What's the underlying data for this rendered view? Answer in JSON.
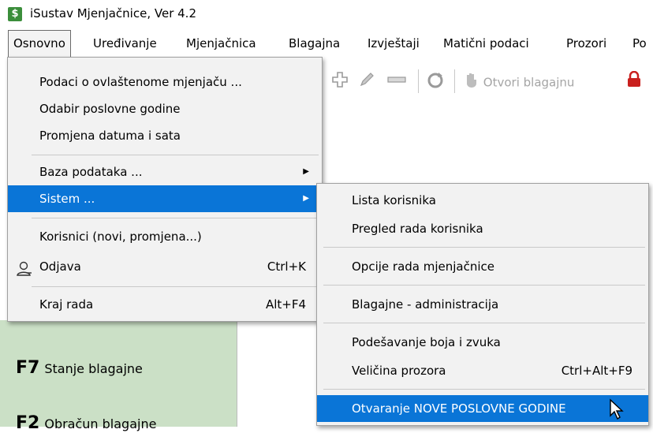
{
  "window": {
    "title": "iSustav Mjenjačnice, Ver 4.2",
    "icon": "dollar-app-icon",
    "icon_glyph": "$"
  },
  "menubar": {
    "items": [
      {
        "label": "Osnovno",
        "active": true
      },
      {
        "label": "Uređivanje"
      },
      {
        "label": "Mjenjačnica"
      },
      {
        "label": "Blagajna"
      },
      {
        "label": "Izvještaji"
      },
      {
        "label": "Matični podaci"
      },
      {
        "label": "Prozori"
      },
      {
        "label": "Po"
      }
    ]
  },
  "toolbar": {
    "otvori_label": "Otvori blagajnu",
    "icons": [
      "plus-icon",
      "pencil-icon",
      "minus-icon",
      "refresh-icon",
      "hand-icon",
      "lock-icon"
    ]
  },
  "osnovno_menu": {
    "items": [
      {
        "label": "Podaci o ovlaštenome mjenjaču ..."
      },
      {
        "label": "Odabir poslovne godine"
      },
      {
        "label": "Promjena datuma i sata"
      },
      {
        "label": "Baza podataka ...",
        "submenu": true
      },
      {
        "label": "Sistem ...",
        "submenu": true,
        "highlighted": true
      },
      {
        "label": "Korisnici (novi, promjena...)"
      },
      {
        "label": "Odjava",
        "shortcut": "Ctrl+K",
        "icon": "user-icon"
      },
      {
        "label": "Kraj rada",
        "shortcut": "Alt+F4"
      }
    ]
  },
  "sistem_menu": {
    "items": [
      {
        "label": "Lista korisnika"
      },
      {
        "label": "Pregled rada korisnika"
      },
      {
        "label": "Opcije rada mjenjačnice"
      },
      {
        "label": "Blagajne - administracija"
      },
      {
        "label": "Podešavanje boja i zvuka"
      },
      {
        "label": "Veličina prozora",
        "shortcut": "Ctrl+Alt+F9"
      },
      {
        "label": "Otvaranje NOVE POSLOVNE GODINE",
        "highlighted": true
      }
    ]
  },
  "left_panel": {
    "items": [
      {
        "key": "F7",
        "label": "Stanje blagajne"
      },
      {
        "key": "F2",
        "label": "Obračun blagajne"
      }
    ]
  },
  "colors": {
    "highlight": "#0a75d7",
    "panel_green": "#cbe0c6",
    "menu_bg": "#f2f2f2"
  }
}
